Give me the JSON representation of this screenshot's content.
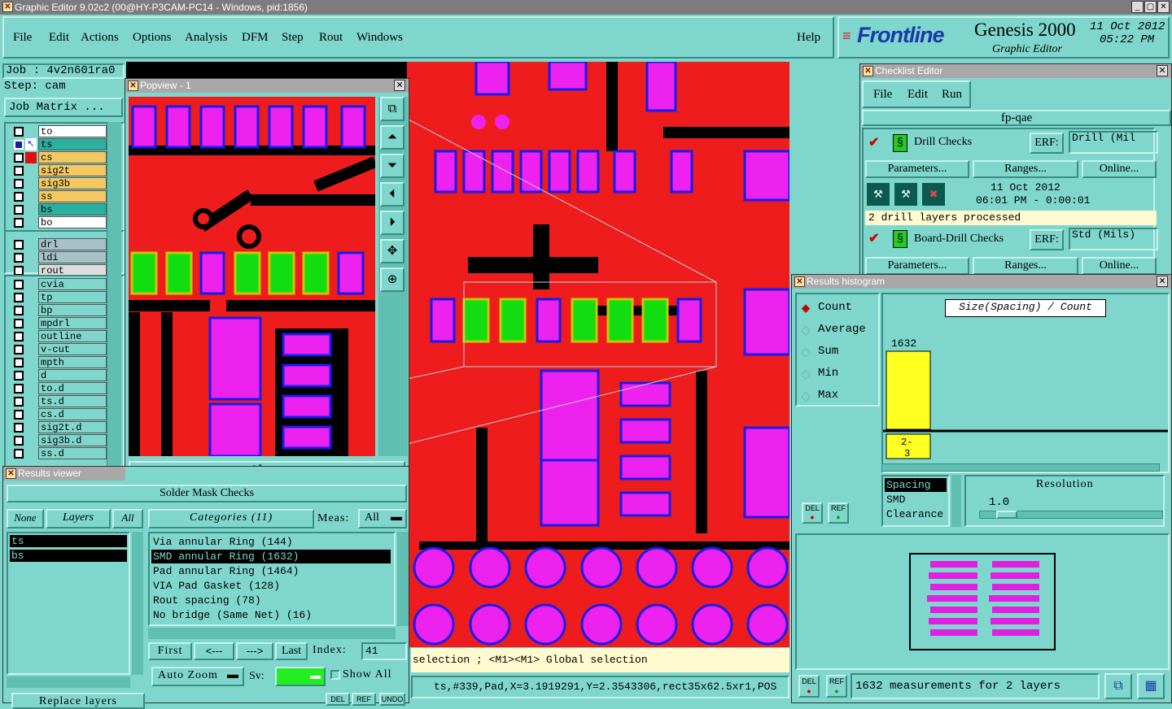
{
  "window": {
    "title": "Graphic Editor 9.02c2 (00@HY-P3CAM-PC14 - Windows, pid:1856)"
  },
  "menu": {
    "items": [
      "File",
      "Edit",
      "Actions",
      "Options",
      "Analysis",
      "DFM",
      "Step",
      "Rout",
      "Windows"
    ],
    "help": "Help"
  },
  "brand": {
    "logo": "Frontline",
    "product": "Genesis 2000",
    "module": "Graphic Editor",
    "date": "11 Oct 2012",
    "time": "05:22 PM"
  },
  "job": {
    "label": "Job : 4v2n601ra0",
    "step": "Step: cam",
    "matrix_button": "Job Matrix ..."
  },
  "layers": {
    "group1": [
      {
        "name": "to",
        "color": "#ffffff"
      },
      {
        "name": "ts",
        "color": "#2bb0a0"
      },
      {
        "name": "cs",
        "color": "#f4c860"
      },
      {
        "name": "sig2t",
        "color": "#f4c860"
      },
      {
        "name": "sig3b",
        "color": "#f4c860"
      },
      {
        "name": "ss",
        "color": "#f4c860"
      },
      {
        "name": "bs",
        "color": "#2bb0a0"
      },
      {
        "name": "bo",
        "color": "#ffffff"
      }
    ],
    "group2": [
      {
        "name": "drl",
        "color": "#a8c0c8"
      },
      {
        "name": "ldi",
        "color": "#a8c0c8"
      },
      {
        "name": "rout",
        "color": "#dddddd"
      }
    ],
    "group3": [
      {
        "name": "cvia",
        "color": "#7fd6cc"
      },
      {
        "name": "tp",
        "color": "#7fd6cc"
      },
      {
        "name": "bp",
        "color": "#7fd6cc"
      },
      {
        "name": "mpdrl",
        "color": "#7fd6cc"
      },
      {
        "name": "outline",
        "color": "#7fd6cc"
      },
      {
        "name": "v-cut",
        "color": "#7fd6cc"
      },
      {
        "name": "mpth",
        "color": "#7fd6cc"
      },
      {
        "name": "d",
        "color": "#7fd6cc"
      },
      {
        "name": "to.d",
        "color": "#7fd6cc"
      },
      {
        "name": "ts.d",
        "color": "#7fd6cc"
      },
      {
        "name": "cs.d",
        "color": "#7fd6cc"
      },
      {
        "name": "sig2t.d",
        "color": "#7fd6cc"
      },
      {
        "name": "sig3b.d",
        "color": "#7fd6cc"
      },
      {
        "name": "ss.d",
        "color": "#7fd6cc"
      }
    ]
  },
  "popview": {
    "title": "Popview - 1",
    "close": "Close"
  },
  "results_viewer": {
    "title": "Results viewer",
    "header": "Solder Mask Checks",
    "none": "None",
    "layers": "Layers",
    "all": "All",
    "layer_list": [
      "ts",
      "bs"
    ],
    "categories_label": "Categories (11)",
    "meas_label": "Meas:",
    "meas_value": "All",
    "categories": [
      "Via annular Ring (144)",
      "SMD annular Ring (1632)",
      "Pad annular Ring (1464)",
      "VIA Pad Gasket (128)",
      "Rout spacing (78)",
      "No bridge (Same Net) (16)"
    ],
    "first": "First",
    "prev": "<---",
    "next": "--->",
    "last": "Last",
    "index_label": "Index:",
    "index_value": "41",
    "auto_zoom": "Auto Zoom",
    "sv_label": "Sv:",
    "show_all": "Show All",
    "replace_layers": "Replace layers",
    "del": "DEL",
    "ref": "REF",
    "undo": "UNDO"
  },
  "status": {
    "hint": "selection ; <M1><M1> Global selection",
    "feature": "ts,#339,Pad,X=3.1919291,Y=2.3543306,rect35x62.5xr1,POS"
  },
  "checklist": {
    "title": "Checklist Editor",
    "menu": [
      "File",
      "Edit",
      "Run"
    ],
    "name": "fp-qae",
    "check1": {
      "name": "Drill Checks",
      "erf": "ERF:",
      "erf_value": "Drill (Mil",
      "date": "11 Oct 2012",
      "time": "06:01 PM - 0:00:01",
      "message": "2 drill layers processed"
    },
    "check2": {
      "name": "Board-Drill Checks",
      "erf": "ERF:",
      "erf_value": "Std (Mils)"
    },
    "parameters": "Parameters...",
    "ranges": "Ranges...",
    "online": "Online..."
  },
  "histogram": {
    "title": "Results histogram",
    "modes": [
      "Count",
      "Average",
      "Sum",
      "Min",
      "Max"
    ],
    "selected_mode": "Count",
    "axis_label": "Size(Spacing) / Count",
    "bar_count": "1632",
    "bar_range": "2-\n3",
    "types": [
      "Spacing",
      "SMD",
      "Clearance"
    ],
    "resolution_label": "Resolution",
    "resolution_value": "1.0",
    "summary": "1632 measurements for 2 layers",
    "del": "DEL",
    "ref": "REF"
  },
  "chart_data": {
    "type": "bar",
    "categories": [
      "2-3"
    ],
    "values": [
      1632
    ],
    "title": "Size(Spacing) / Count",
    "xlabel": "",
    "ylabel": ""
  }
}
